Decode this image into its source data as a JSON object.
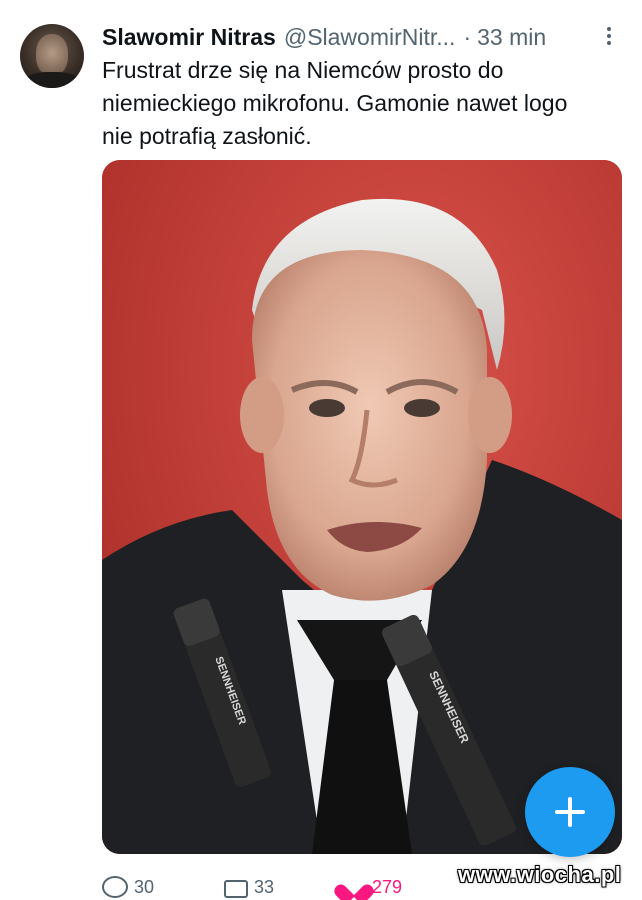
{
  "tweet": {
    "author_name": "Slawomir Nitras",
    "author_handle": "@SlawomirNitr...",
    "separator": "·",
    "time": "33 min",
    "text_lines": [
      "Frustrat drze się na Niemców prosto do",
      "niemieckiego mikrofonu. Gamonie nawet logo",
      "nie potrafią zasłonić."
    ],
    "actions": {
      "reply_count": "30",
      "retweet_count": "33",
      "like_count": "279"
    }
  },
  "media": {
    "microphone_brand_left": "SENNHEISER",
    "microphone_brand_right": "SENNHEISER"
  },
  "watermark": "www.wiocha.pl",
  "icons": {
    "more": "more-vertical-icon",
    "compose": "plus-icon",
    "reply": "reply-icon",
    "retweet": "retweet-icon",
    "like": "heart-icon"
  },
  "colors": {
    "accent": "#1d9bf0",
    "secondary_text": "#536471",
    "like": "#f91880",
    "photo_background": "#c53c33"
  }
}
